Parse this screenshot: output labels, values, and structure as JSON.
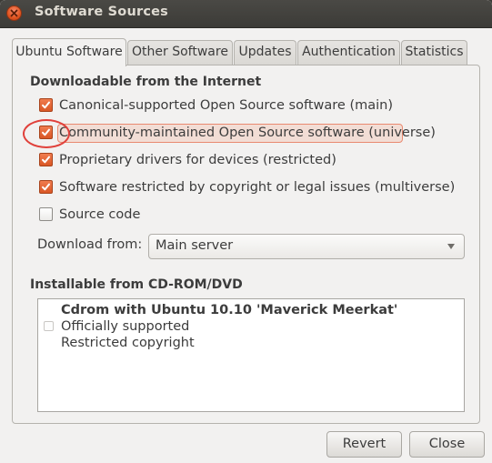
{
  "window": {
    "title": "Software Sources"
  },
  "tabs": [
    {
      "label": "Ubuntu Software",
      "active": true
    },
    {
      "label": "Other Software",
      "active": false
    },
    {
      "label": "Updates",
      "active": false
    },
    {
      "label": "Authentication",
      "active": false
    },
    {
      "label": "Statistics",
      "active": false
    }
  ],
  "downloadable": {
    "heading": "Downloadable from the Internet",
    "items": [
      {
        "label": "Canonical-supported Open Source software (main)",
        "checked": true
      },
      {
        "label": "Community-maintained Open Source software (universe)",
        "checked": true,
        "highlighted": true
      },
      {
        "label": "Proprietary drivers for devices (restricted)",
        "checked": true
      },
      {
        "label": "Software restricted by copyright or legal issues (multiverse)",
        "checked": true
      },
      {
        "label": "Source code",
        "checked": false
      }
    ],
    "download_from_label": "Download from:",
    "download_from_value": "Main server"
  },
  "cdrom": {
    "heading": "Installable from CD-ROM/DVD",
    "entry": {
      "checked": false,
      "title": "Cdrom with Ubuntu 10.10 'Maverick Meerkat'",
      "line2": "Officially supported",
      "line3": "Restricted copyright"
    }
  },
  "buttons": {
    "revert": "Revert",
    "close": "Close"
  },
  "colors": {
    "accent": "#e0541f",
    "checkbox_checked": "#dd6233",
    "annotation": "#e0413b",
    "titlebar": "#3c3b37"
  },
  "icons": {
    "close": "close-icon",
    "check": "check-icon",
    "dropdown": "chevron-down-icon"
  }
}
